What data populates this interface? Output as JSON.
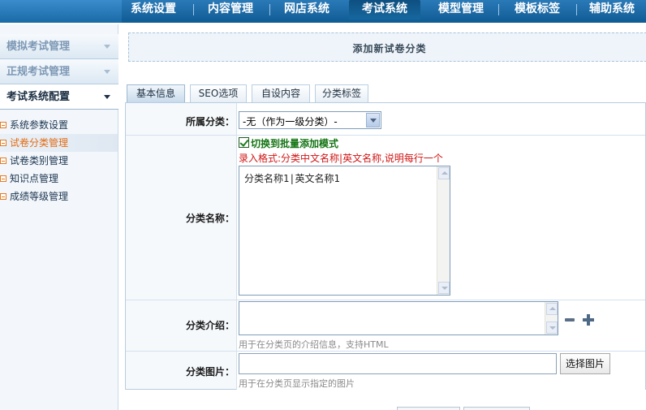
{
  "topnav": {
    "items": [
      "系统设置",
      "内容管理",
      "网店系统",
      "考试系统",
      "模型管理",
      "模板标签",
      "辅助系统"
    ],
    "active_index": 3
  },
  "sidebar": {
    "sections": [
      {
        "label": "模拟考试管理",
        "active": false
      },
      {
        "label": "正规考试管理",
        "active": false
      },
      {
        "label": "考试系统配置",
        "active": true
      }
    ],
    "items": [
      {
        "label": "系统参数设置",
        "active": false
      },
      {
        "label": "试卷分类管理",
        "active": true
      },
      {
        "label": "试卷类别管理",
        "active": false
      },
      {
        "label": "知识点管理",
        "active": false
      },
      {
        "label": "成绩等级管理",
        "active": false
      }
    ]
  },
  "page": {
    "title": "添加新试卷分类"
  },
  "tabs": [
    "基本信息",
    "SEO选项",
    "自设内容",
    "分类标签"
  ],
  "form": {
    "parent": {
      "label": "所属分类：",
      "selected": "-无（作为一级分类）-"
    },
    "name": {
      "label": "分类名称：",
      "batch_checkbox_label": "切换到批量添加模式",
      "batch_checked": true,
      "format_hint": "录入格式:分类中文名称|英文名称,说明每行一个",
      "value": "分类名称1|英文名称1"
    },
    "intro": {
      "label": "分类介绍：",
      "value": "",
      "hint": "用于在分类页的介绍信息，支持HTML"
    },
    "image": {
      "label": "分类图片：",
      "value": "",
      "button": "选择图片",
      "hint": "用于在分类页显示指定的图片"
    }
  },
  "colors": {
    "nav_blue": "#1a6aa6",
    "active_orange": "#e46b12",
    "hint_red": "#d01515",
    "check_green": "#147414"
  }
}
